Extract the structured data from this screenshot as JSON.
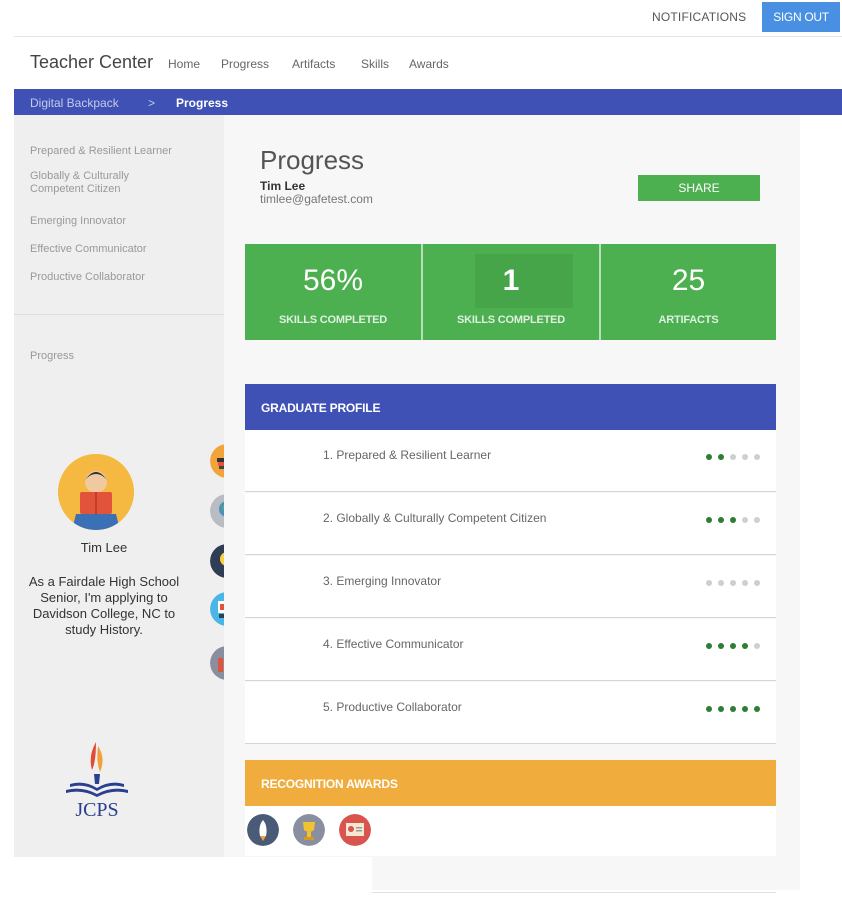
{
  "topbar": {
    "notifications_label": "NOTIFICATIONS",
    "signout_label": "SIGN OUT",
    "signout_color": "#4a90e2"
  },
  "nav": {
    "brand": "Teacher Center",
    "links": [
      "Home",
      "Progress",
      "Artifacts",
      "Skills",
      "Awards"
    ]
  },
  "breadcrumb": {
    "root": "Digital Backpack",
    "separator": ">",
    "current": "Progress",
    "bar_color": "#3f51b5"
  },
  "sidebar": {
    "competencies": [
      "Prepared & Resilient Learner",
      "Globally & Culturally Competent Citizen",
      "Emerging Innovator",
      "Effective Communicator",
      "Productive Collaborator"
    ],
    "section_label": "Progress",
    "student_name": "Tim Lee",
    "bio": "As a Fairdale High School Senior, I'm applying to Davidson College, NC to study History.",
    "logo_text": "JCPS",
    "skill_icons": [
      "books-icon",
      "globe-icon",
      "lightbulb-icon",
      "presentation-icon",
      "team-icon"
    ]
  },
  "main": {
    "title": "Progress",
    "name": "Tim Lee",
    "email": "timlee@gafetest.com",
    "share_label": "SHARE",
    "stats": [
      {
        "value": "56%",
        "label": "SKILLS COMPLETED"
      },
      {
        "value": "1",
        "label": "SKILLS COMPLETED"
      },
      {
        "value": "25",
        "label": "ARTIFACTS"
      }
    ],
    "stats_color": "#4caf50",
    "graduate_profile": {
      "heading": "GRADUATE PROFILE",
      "items": [
        {
          "label": "1. Prepared & Resilient Learner",
          "level": 2,
          "max": 5
        },
        {
          "label": "2. Globally & Culturally Competent Citizen",
          "level": 3,
          "max": 5
        },
        {
          "label": "3. Emerging Innovator",
          "level": 0,
          "max": 5
        },
        {
          "label": "4. Effective Communicator",
          "level": 4,
          "max": 5
        },
        {
          "label": "5. Productive Collaborator",
          "level": 5,
          "max": 5
        }
      ]
    },
    "recognition_awards": {
      "heading": "RECOGNITION AWARDS",
      "heading_color": "#f0ad3e",
      "icons": [
        "rocket-award-icon",
        "trophy-award-icon",
        "certificate-award-icon"
      ]
    }
  }
}
